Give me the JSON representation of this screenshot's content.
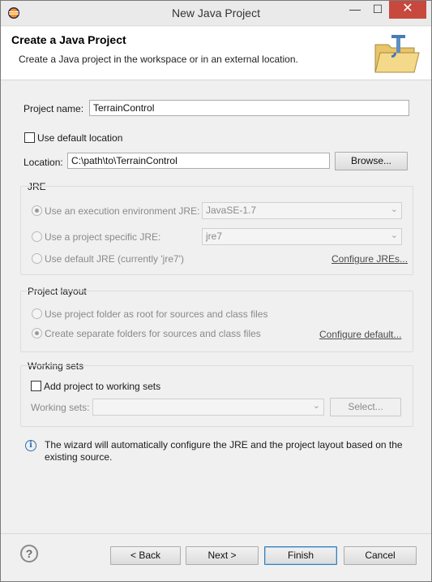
{
  "window": {
    "title": "New Java Project",
    "minimize": "—",
    "maximize": "☐",
    "close": "✕"
  },
  "header": {
    "title": "Create a Java Project",
    "description": "Create a Java project in the workspace or in an external location."
  },
  "project": {
    "name_label": "Project name:",
    "name_value": "TerrainControl",
    "use_default_location_label": "Use default location",
    "use_default_location_checked": false,
    "location_label": "Location:",
    "location_value": "C:\\path\\to\\TerrainControl",
    "browse_label": "Browse..."
  },
  "jre": {
    "title": "JRE",
    "option_env_label": "Use an execution environment JRE:",
    "env_value": "JavaSE-1.7",
    "option_specific_label": "Use a project specific JRE:",
    "specific_value": "jre7",
    "option_default_label": "Use default JRE (currently 'jre7')",
    "configure_link": "Configure JREs..."
  },
  "layout": {
    "title": "Project layout",
    "option_root_label": "Use project folder as root for sources and class files",
    "option_separate_label": "Create separate folders for sources and class files",
    "configure_link": "Configure default..."
  },
  "working_sets": {
    "title": "Working sets",
    "add_label": "Add project to working sets",
    "sets_label": "Working sets:",
    "select_label": "Select..."
  },
  "info": {
    "message": "The wizard will automatically configure the JRE and the project layout based on the existing source."
  },
  "buttons": {
    "back": "< Back",
    "next": "Next >",
    "finish": "Finish",
    "cancel": "Cancel",
    "help": "?"
  },
  "colors": {
    "close_button": "#c7483d",
    "default_button_border": "#3c7fb1",
    "info_icon": "#2f6fb3"
  }
}
